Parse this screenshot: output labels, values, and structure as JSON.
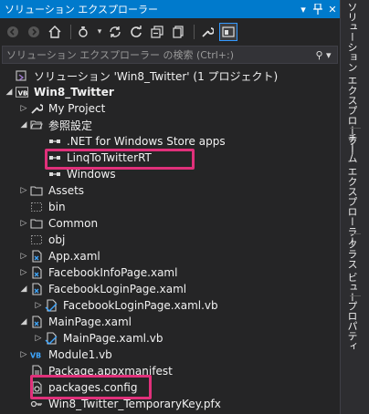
{
  "window": {
    "title": "ソリューション エクスプローラー"
  },
  "search": {
    "placeholder": "ソリューション エクスプローラー の検索 (Ctrl+:)"
  },
  "tree": {
    "solution": "ソリューション 'Win8_Twitter' (1 プロジェクト)",
    "project": "Win8_Twitter",
    "items": {
      "my_project": "My Project",
      "references": "参照設定",
      "ref_netcore": ".NET for Windows Store apps",
      "ref_linq": "LinqToTwitterRT",
      "ref_windows": "Windows",
      "assets": "Assets",
      "bin": "bin",
      "common": "Common",
      "obj": "obj",
      "app_xaml": "App.xaml",
      "facebook_info": "FacebookInfoPage.xaml",
      "facebook_login": "FacebookLoginPage.xaml",
      "facebook_login_vb": "FacebookLoginPage.xaml.vb",
      "main_page": "MainPage.xaml",
      "main_page_vb": "MainPage.xaml.vb",
      "module1": "Module1.vb",
      "manifest": "Package.appxmanifest",
      "packages_config": "packages.config",
      "temp_key": "Win8_Twitter_TemporaryKey.pfx"
    }
  },
  "sidebar": {
    "tabs": [
      "ソリューション エクスプローラー",
      "チーム エクスプローラー",
      "クラス ビュー",
      "プロパティ"
    ]
  },
  "colors": {
    "accent": "#007acc",
    "highlight": "#e0307a",
    "background": "#252526"
  }
}
